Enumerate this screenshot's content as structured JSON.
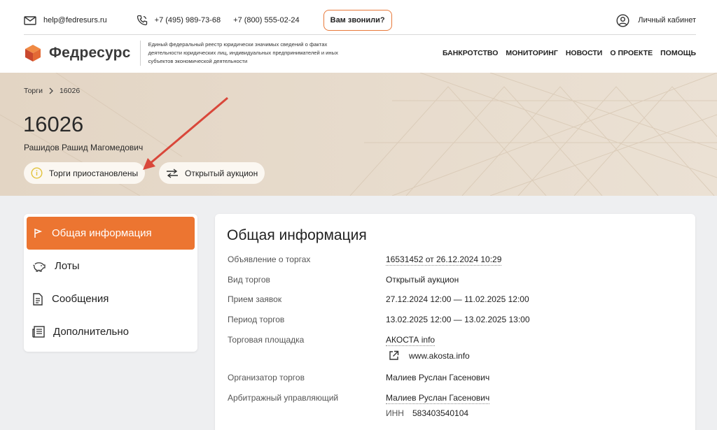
{
  "header": {
    "email": "help@fedresurs.ru",
    "phone1": "+7 (495) 989-73-68",
    "phone2": "+7 (800) 555-02-24",
    "callback_label": "Вам звонили?",
    "cabinet_label": "Личный кабинет",
    "logo_text": "Федресурс",
    "tagline": "Единый федеральный реестр юридически значимых сведений о фактах деятельности юридических лиц, индивидуальных предпринимателей и иных субъектов экономической деятельности",
    "nav": [
      "БАНКРОТСТВО",
      "МОНИТОРИНГ",
      "НОВОСТИ",
      "О ПРОЕКТЕ",
      "ПОМОЩЬ"
    ]
  },
  "breadcrumb": {
    "parent": "Торги",
    "current": "16026"
  },
  "hero": {
    "title": "16026",
    "subtitle": "Рашидов Рашид Магомедович",
    "status_chip": "Торги приостановлены",
    "type_chip": "Открытый аукцион"
  },
  "sidebar": {
    "items": [
      {
        "label": "Общая информация",
        "icon": "flag-icon"
      },
      {
        "label": "Лоты",
        "icon": "piggy-bank-icon"
      },
      {
        "label": "Сообщения",
        "icon": "document-icon"
      },
      {
        "label": "Дополнительно",
        "icon": "newspaper-icon"
      }
    ]
  },
  "content": {
    "title": "Общая информация",
    "rows": [
      {
        "label": "Объявление о торгах",
        "value": "16531452 от 26.12.2024 10:29"
      },
      {
        "label": "Вид торгов",
        "value": "Открытый аукцион"
      },
      {
        "label": "Прием заявок",
        "value": "27.12.2024 12:00 — 11.02.2025 12:00"
      },
      {
        "label": "Период торгов",
        "value": "13.02.2025 12:00 — 13.02.2025 13:00"
      },
      {
        "label": "Торговая площадка",
        "value": "АКОСТА info"
      },
      {
        "label": "Организатор торгов",
        "value": "Малиев Руслан Гасенович"
      },
      {
        "label": "Арбитражный управляющий",
        "value": "Малиев Руслан Гасенович"
      }
    ],
    "site_link": "www.akosta.info",
    "inn_label": "ИНН",
    "inn_value": "583403540104"
  },
  "colors": {
    "accent": "#ec7531",
    "hero_bg": "#e6d9c9",
    "page_bg": "#eeeff1",
    "annotation_arrow": "#d9473a"
  }
}
